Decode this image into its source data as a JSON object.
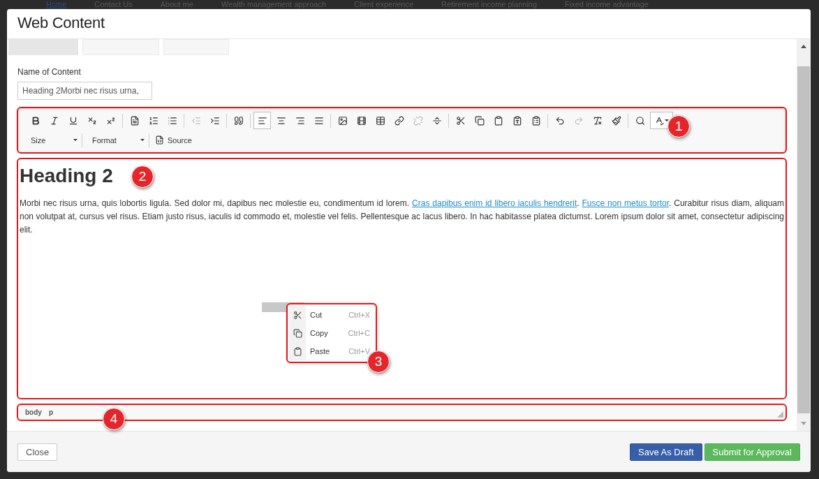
{
  "background_nav": [
    {
      "label": "Home",
      "selected": true
    },
    {
      "label": "Contact Us",
      "selected": false
    },
    {
      "label": "About me",
      "selected": false
    },
    {
      "label": "Wealth management approach",
      "selected": false
    },
    {
      "label": "Client experience",
      "selected": false
    },
    {
      "label": "Retirement income planning",
      "selected": false
    },
    {
      "label": "Fixed income advantage",
      "selected": false
    }
  ],
  "window": {
    "title": "Web Content"
  },
  "tabs": [
    {
      "selected": true
    },
    {
      "selected": false
    },
    {
      "selected": false
    }
  ],
  "name_field": {
    "label": "Name of Content",
    "value": "Heading 2Morbi nec risus urna,"
  },
  "toolbar": {
    "annotation": "1",
    "groups": [
      [
        {
          "kind": "bold",
          "disabled": false,
          "selected": false
        },
        {
          "kind": "italic",
          "disabled": false,
          "selected": false
        },
        {
          "kind": "underline",
          "disabled": false,
          "selected": false
        },
        {
          "kind": "subscript",
          "disabled": false,
          "selected": false
        },
        {
          "kind": "superscript",
          "disabled": false,
          "selected": false
        }
      ],
      [
        {
          "kind": "document",
          "disabled": false,
          "selected": false
        },
        {
          "kind": "ordered-list",
          "disabled": false,
          "selected": false
        },
        {
          "kind": "bulleted-list",
          "disabled": false,
          "selected": false
        }
      ],
      [
        {
          "kind": "outdent",
          "disabled": true,
          "selected": false
        },
        {
          "kind": "indent",
          "disabled": false,
          "selected": false
        }
      ],
      [
        {
          "kind": "quote",
          "disabled": false,
          "selected": false
        }
      ],
      [
        {
          "kind": "align-left",
          "disabled": false,
          "selected": true
        },
        {
          "kind": "align-center",
          "disabled": false,
          "selected": false
        },
        {
          "kind": "align-right",
          "disabled": false,
          "selected": false
        },
        {
          "kind": "align-justify",
          "disabled": false,
          "selected": false
        }
      ],
      [
        {
          "kind": "image",
          "disabled": false,
          "selected": false
        },
        {
          "kind": "video",
          "disabled": false,
          "selected": false
        },
        {
          "kind": "table",
          "disabled": false,
          "selected": false
        },
        {
          "kind": "link",
          "disabled": false,
          "selected": false
        },
        {
          "kind": "unlink",
          "disabled": true,
          "selected": false
        },
        {
          "kind": "horizontal-rule",
          "disabled": false,
          "selected": false
        }
      ],
      [
        {
          "kind": "cut",
          "disabled": false,
          "selected": false
        },
        {
          "kind": "copy",
          "disabled": false,
          "selected": false
        },
        {
          "kind": "paste",
          "disabled": false,
          "selected": false
        },
        {
          "kind": "paste-text",
          "disabled": false,
          "selected": false
        },
        {
          "kind": "paste-word",
          "disabled": false,
          "selected": false
        }
      ],
      [
        {
          "kind": "undo",
          "disabled": false,
          "selected": false
        },
        {
          "kind": "redo",
          "disabled": true,
          "selected": false
        },
        {
          "kind": "clear-format",
          "disabled": false,
          "selected": false
        },
        {
          "kind": "paintbrush",
          "disabled": false,
          "selected": false
        }
      ],
      [
        {
          "kind": "search",
          "disabled": false,
          "selected": false
        },
        {
          "kind": "spellcheck",
          "disabled": false,
          "selected": true
        }
      ]
    ],
    "row2": [
      {
        "kind": "dropdown",
        "label": "Size"
      },
      {
        "kind": "dropdown",
        "label": "Format"
      },
      {
        "kind": "button",
        "label": "Source"
      }
    ]
  },
  "editor": {
    "annotation": "2",
    "heading": "Heading 2",
    "paragraph": [
      {
        "text": "Morbi nec risus urna, quis lobortis ligula. Sed dolor mi, dapibus nec molestie eu, condimentum id lorem. ",
        "link": false
      },
      {
        "text": "Cras dapibus enim id libero iaculis hendrerit",
        "link": true
      },
      {
        "text": ". ",
        "link": false
      },
      {
        "text": "Fusce non metus tortor",
        "link": true
      },
      {
        "text": ". Curabitur risus diam, aliquam non volutpat at, cursus vel risus. Etiam justo risus, iaculis id commodo et, molestie vel felis. Pellentesque ac lacus libero. In hac habitasse platea dictumst. Lorem ipsum dolor sit amet, consectetur adipiscing elit.",
        "link": false
      }
    ]
  },
  "context_menu": {
    "annotation": "3",
    "items": [
      {
        "kind": "cut",
        "label": "Cut",
        "shortcut": "Ctrl+X"
      },
      {
        "kind": "copy",
        "label": "Copy",
        "shortcut": "Ctrl+C"
      },
      {
        "kind": "paste",
        "label": "Paste",
        "shortcut": "Ctrl+V"
      }
    ]
  },
  "path_bar": {
    "annotation": "4",
    "elements": [
      "body",
      "p"
    ]
  },
  "footer": {
    "buttons": [
      {
        "kind": "default",
        "label": "Close"
      },
      {
        "kind": "primary",
        "label": "Save As Draft"
      },
      {
        "kind": "success",
        "label": "Submit for Approval"
      }
    ]
  }
}
